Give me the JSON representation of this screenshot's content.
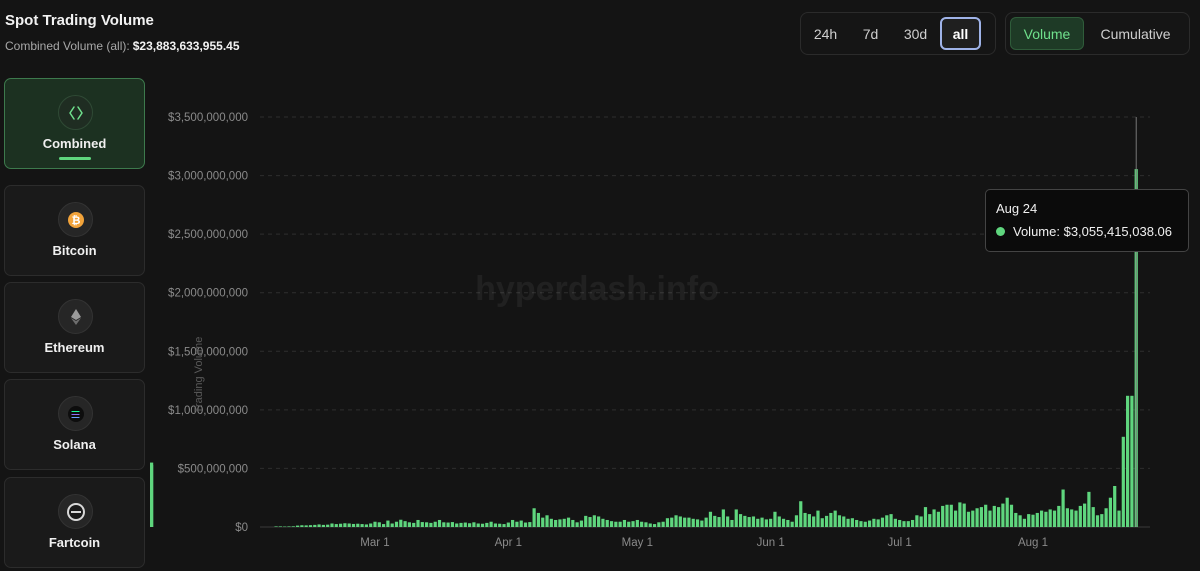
{
  "header": {
    "title": "Spot Trading Volume",
    "subtitle_label": "Combined Volume (all):",
    "subtitle_value": "$23,883,633,955.45"
  },
  "time_ranges": [
    "24h",
    "7d",
    "30d",
    "all"
  ],
  "selected_time_range": "all",
  "modes": [
    "Volume",
    "Cumulative"
  ],
  "selected_mode": "Volume",
  "assets": [
    {
      "label": "Combined",
      "icon": "code-brackets-icon",
      "active": true
    },
    {
      "label": "Bitcoin",
      "icon": "bitcoin-icon",
      "active": false
    },
    {
      "label": "Ethereum",
      "icon": "ethereum-icon",
      "active": false
    },
    {
      "label": "Solana",
      "icon": "solana-icon",
      "active": false
    },
    {
      "label": "Fartcoin",
      "icon": "fartcoin-icon",
      "active": false
    }
  ],
  "watermark": "hyperdash.info",
  "tooltip": {
    "date": "Aug 24",
    "label": "Volume: $3,055,415,038.06"
  },
  "colors": {
    "bar": "#5fd67e",
    "accent": "#5fd67e",
    "background": "#141414"
  },
  "chart_data": {
    "type": "bar",
    "ylabel": "Trading Volume",
    "ylim": [
      0,
      3500000000
    ],
    "y_ticks": [
      "$0",
      "$500,000,000",
      "$1,000,000,000",
      "$1,500,000,000",
      "$2,000,000,000",
      "$2,500,000,000",
      "$3,000,000,000",
      "$3,500,000,000"
    ],
    "y_tick_values": [
      0,
      500000000,
      1000000000,
      1500000000,
      2000000000,
      2500000000,
      3000000000,
      3500000000
    ],
    "x_ticks": [
      "Mar 1",
      "Apr 1",
      "May 1",
      "Jun 1",
      "Jul 1",
      "Aug 1"
    ],
    "x_tick_dates": [
      "2025-03-01",
      "2025-04-01",
      "2025-05-01",
      "2025-06-01",
      "2025-07-01",
      "2025-08-01"
    ],
    "grid": true,
    "series": [
      {
        "dates": [
          "2025-02-06",
          "2025-02-07",
          "2025-02-08",
          "2025-02-09",
          "2025-02-10",
          "2025-02-11",
          "2025-02-12",
          "2025-02-13",
          "2025-02-14",
          "2025-02-15",
          "2025-02-16",
          "2025-02-17",
          "2025-02-18",
          "2025-02-19",
          "2025-02-20",
          "2025-02-21",
          "2025-02-22",
          "2025-02-23",
          "2025-02-24",
          "2025-02-25",
          "2025-02-26",
          "2025-02-27",
          "2025-02-28",
          "2025-03-01",
          "2025-03-02",
          "2025-03-03",
          "2025-03-04",
          "2025-03-05",
          "2025-03-06",
          "2025-03-07",
          "2025-03-08",
          "2025-03-09",
          "2025-03-10",
          "2025-03-11",
          "2025-03-12",
          "2025-03-13",
          "2025-03-14",
          "2025-03-15",
          "2025-03-16",
          "2025-03-17",
          "2025-03-18",
          "2025-03-19",
          "2025-03-20",
          "2025-03-21",
          "2025-03-22",
          "2025-03-23",
          "2025-03-24",
          "2025-03-25",
          "2025-03-26",
          "2025-03-27",
          "2025-03-28",
          "2025-03-29",
          "2025-03-30",
          "2025-03-31",
          "2025-04-01",
          "2025-04-02",
          "2025-04-03",
          "2025-04-04",
          "2025-04-05",
          "2025-04-06",
          "2025-04-07",
          "2025-04-08",
          "2025-04-09",
          "2025-04-10",
          "2025-04-11",
          "2025-04-12",
          "2025-04-13",
          "2025-04-14",
          "2025-04-15",
          "2025-04-16",
          "2025-04-17",
          "2025-04-18",
          "2025-04-19",
          "2025-04-20",
          "2025-04-21",
          "2025-04-22",
          "2025-04-23",
          "2025-04-24",
          "2025-04-25",
          "2025-04-26",
          "2025-04-27",
          "2025-04-28",
          "2025-04-29",
          "2025-04-30",
          "2025-05-01",
          "2025-05-02",
          "2025-05-03",
          "2025-05-04",
          "2025-05-05",
          "2025-05-06",
          "2025-05-07",
          "2025-05-08",
          "2025-05-09",
          "2025-05-10",
          "2025-05-11",
          "2025-05-12",
          "2025-05-13",
          "2025-05-14",
          "2025-05-15",
          "2025-05-16",
          "2025-05-17",
          "2025-05-18",
          "2025-05-19",
          "2025-05-20",
          "2025-05-21",
          "2025-05-22",
          "2025-05-23",
          "2025-05-24",
          "2025-05-25",
          "2025-05-26",
          "2025-05-27",
          "2025-05-28",
          "2025-05-29",
          "2025-05-30",
          "2025-05-31",
          "2025-06-01",
          "2025-06-02",
          "2025-06-03",
          "2025-06-04",
          "2025-06-05",
          "2025-06-06",
          "2025-06-07",
          "2025-06-08",
          "2025-06-09",
          "2025-06-10",
          "2025-06-11",
          "2025-06-12",
          "2025-06-13",
          "2025-06-14",
          "2025-06-15",
          "2025-06-16",
          "2025-06-17",
          "2025-06-18",
          "2025-06-19",
          "2025-06-20",
          "2025-06-21",
          "2025-06-22",
          "2025-06-23",
          "2025-06-24",
          "2025-06-25",
          "2025-06-26",
          "2025-06-27",
          "2025-06-28",
          "2025-06-29",
          "2025-06-30",
          "2025-07-01",
          "2025-07-02",
          "2025-07-03",
          "2025-07-04",
          "2025-07-05",
          "2025-07-06",
          "2025-07-07",
          "2025-07-08",
          "2025-07-09",
          "2025-07-10",
          "2025-07-11",
          "2025-07-12",
          "2025-07-13",
          "2025-07-14",
          "2025-07-15",
          "2025-07-16",
          "2025-07-17",
          "2025-07-18",
          "2025-07-19",
          "2025-07-20",
          "2025-07-21",
          "2025-07-22",
          "2025-07-23",
          "2025-07-24",
          "2025-07-25",
          "2025-07-26",
          "2025-07-27",
          "2025-07-28",
          "2025-07-29",
          "2025-07-30",
          "2025-07-31",
          "2025-08-01",
          "2025-08-02",
          "2025-08-03",
          "2025-08-04",
          "2025-08-05",
          "2025-08-06",
          "2025-08-07",
          "2025-08-08",
          "2025-08-09",
          "2025-08-10",
          "2025-08-11",
          "2025-08-12",
          "2025-08-13",
          "2025-08-14",
          "2025-08-15",
          "2025-08-16",
          "2025-08-17",
          "2025-08-18",
          "2025-08-19",
          "2025-08-20",
          "2025-08-21",
          "2025-08-22",
          "2025-08-23",
          "2025-08-24",
          "2025-08-25"
        ],
        "values": [
          5000000,
          5000000,
          4000000,
          5000000,
          6000000,
          12000000,
          15000000,
          14000000,
          16000000,
          18000000,
          22000000,
          18000000,
          20000000,
          30000000,
          25000000,
          28000000,
          32000000,
          30000000,
          26000000,
          28000000,
          25000000,
          22000000,
          30000000,
          45000000,
          40000000,
          25000000,
          55000000,
          30000000,
          45000000,
          62000000,
          50000000,
          40000000,
          35000000,
          60000000,
          42000000,
          40000000,
          35000000,
          45000000,
          60000000,
          40000000,
          38000000,
          42000000,
          30000000,
          35000000,
          38000000,
          32000000,
          40000000,
          30000000,
          28000000,
          35000000,
          45000000,
          30000000,
          28000000,
          25000000,
          38000000,
          60000000,
          45000000,
          55000000,
          38000000,
          42000000,
          160000000,
          120000000,
          80000000,
          100000000,
          70000000,
          60000000,
          65000000,
          70000000,
          80000000,
          60000000,
          40000000,
          55000000,
          95000000,
          85000000,
          100000000,
          90000000,
          70000000,
          60000000,
          50000000,
          45000000,
          45000000,
          60000000,
          45000000,
          50000000,
          60000000,
          45000000,
          40000000,
          30000000,
          25000000,
          40000000,
          45000000,
          75000000,
          80000000,
          100000000,
          90000000,
          80000000,
          80000000,
          70000000,
          65000000,
          55000000,
          80000000,
          130000000,
          95000000,
          85000000,
          150000000,
          90000000,
          60000000,
          150000000,
          110000000,
          95000000,
          85000000,
          90000000,
          70000000,
          80000000,
          65000000,
          70000000,
          130000000,
          90000000,
          70000000,
          60000000,
          45000000,
          100000000,
          220000000,
          120000000,
          110000000,
          90000000,
          140000000,
          75000000,
          95000000,
          120000000,
          140000000,
          100000000,
          90000000,
          70000000,
          75000000,
          60000000,
          50000000,
          45000000,
          55000000,
          70000000,
          65000000,
          80000000,
          100000000,
          110000000,
          70000000,
          60000000,
          50000000,
          50000000,
          60000000,
          100000000,
          90000000,
          170000000,
          110000000,
          150000000,
          130000000,
          180000000,
          190000000,
          190000000,
          140000000,
          210000000,
          200000000,
          130000000,
          140000000,
          160000000,
          170000000,
          190000000,
          140000000,
          180000000,
          170000000,
          200000000,
          250000000,
          190000000,
          120000000,
          100000000,
          70000000,
          110000000,
          105000000,
          120000000,
          140000000,
          130000000,
          150000000,
          140000000,
          180000000,
          320000000,
          160000000,
          150000000,
          140000000,
          180000000,
          200000000,
          300000000,
          170000000,
          100000000,
          110000000,
          160000000,
          250000000,
          350000000,
          140000000,
          770000000,
          1120000000,
          1120000000,
          3055415038.06,
          550000000,
          530000000
        ]
      }
    ]
  }
}
